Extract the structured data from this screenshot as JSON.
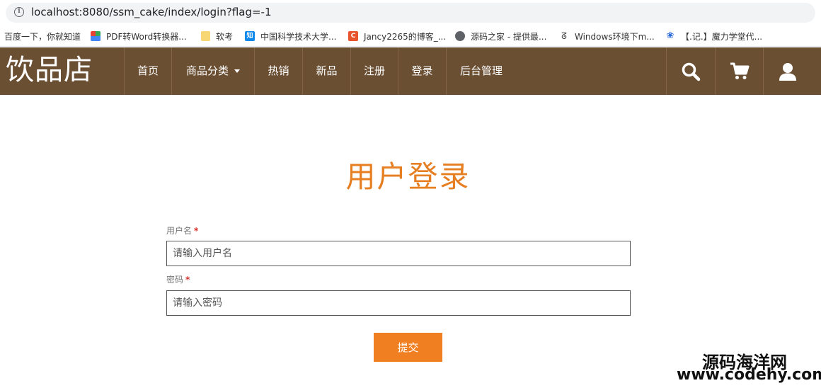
{
  "browser": {
    "url": "localhost:8080/ssm_cake/index/login?flag=-1",
    "info_icon": "i"
  },
  "bookmarks": [
    {
      "label": "百度一下，你就知道",
      "icon": "none"
    },
    {
      "label": "PDF转Word转换器...",
      "icon": "colorful-grid-icon"
    },
    {
      "label": "软考",
      "icon": "folder-icon"
    },
    {
      "label": "中国科学技术大学...",
      "icon": "zhi-icon",
      "icon_text": "知"
    },
    {
      "label": "Jancy2265的博客_...",
      "icon": "csdn-icon",
      "icon_text": "C"
    },
    {
      "label": "源码之家 - 提供最...",
      "icon": "globe-icon"
    },
    {
      "label": "Windows环境下m...",
      "icon": "logo-icon"
    },
    {
      "label": "【.记.】魔力学堂代...",
      "icon": "paw-icon"
    }
  ],
  "nav": {
    "logo": "饮品店",
    "items": [
      "首页",
      "商品分类",
      "热销",
      "新品",
      "注册",
      "登录",
      "后台管理"
    ],
    "icons": [
      "search-icon",
      "cart-icon",
      "user-icon"
    ]
  },
  "login": {
    "title": "用户登录",
    "username_label": "用户名",
    "username_placeholder": "请输入用户名",
    "password_label": "密码",
    "password_placeholder": "请输入密码",
    "required_mark": "*",
    "submit_label": "提交"
  },
  "watermark": {
    "line1": "源码海洋网",
    "line2": "www.codehy.com"
  },
  "colors": {
    "nav_bg": "#6b4f33",
    "title": "#e67e22",
    "submit_bg": "#f07f21"
  }
}
